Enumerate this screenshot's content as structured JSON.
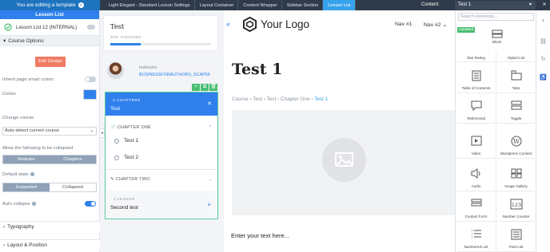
{
  "topbar": {
    "editing_notice": "You are editing a template",
    "breadcrumbs": [
      "Light Elegant - Standard Lesson Settings",
      "Layout Container",
      "Content Wrapper",
      "Sidebar Section",
      "Lesson List"
    ],
    "content_label": "Content:",
    "content_value": "Test 1"
  },
  "left_panel": {
    "title": "Lesson List",
    "element_name": "Lesson List 12 (INTERNAL)",
    "section_course_options": "Course Options",
    "edit_design": "Edit Design",
    "inherit_label": "Inherit page smart colors",
    "colors_label": "Colors",
    "colors_value": "#2f80ed",
    "change_course_label": "Change course",
    "course_select": "Auto detect current course",
    "collapse_label": "Allow the following to be collapsed",
    "collapse_options": [
      "Modules",
      "Chapters"
    ],
    "default_state_label": "Default state",
    "state_options": [
      "Expanded",
      "Collapsed"
    ],
    "auto_collapse_label": "Auto collapse",
    "section_typography": "Typography",
    "section_layout": "Layout & Position"
  },
  "progress_card": {
    "title": "Test",
    "progress_text": "30% FINISHED",
    "progress_value": 0.3
  },
  "instructor": {
    "label": "Instructor",
    "name": "BUSINESSFORAUTHORS_SCAP56"
  },
  "lesson_list": {
    "chapters_count": "3 CHAPTERS",
    "title": "Test",
    "chapter_one": "CHAPTER ONE",
    "lessons": [
      "Test 1",
      "Test 2"
    ],
    "chapter_two": "CHAPTER TWO",
    "lesson_count": "1 LESSON",
    "lesson_title": "Second test"
  },
  "main": {
    "logo_text": "Your Logo",
    "nav": [
      "Nav #1",
      "Nav #2"
    ],
    "heading": "Test 1",
    "breadcrumb": [
      "Course",
      "Test",
      "Test",
      "Chapter One"
    ],
    "breadcrumb_current": "Test 1",
    "placeholder_text": "Enter your text here..."
  },
  "right_panel": {
    "search_placeholder": "Search elements...",
    "updated_badge": "Updated",
    "block_label": "Block",
    "elements": [
      [
        "Star Rating",
        "Styled List"
      ],
      [
        "Table of Contents",
        "Tabs"
      ],
      [
        "Testimonial",
        "Toggle"
      ],
      [
        "Video",
        "Wordpress Content"
      ],
      [
        "Audio",
        "Image Gallery"
      ],
      [
        "Contact Form",
        "Number Counter"
      ],
      [
        "Numbered List",
        "Post List"
      ]
    ]
  }
}
